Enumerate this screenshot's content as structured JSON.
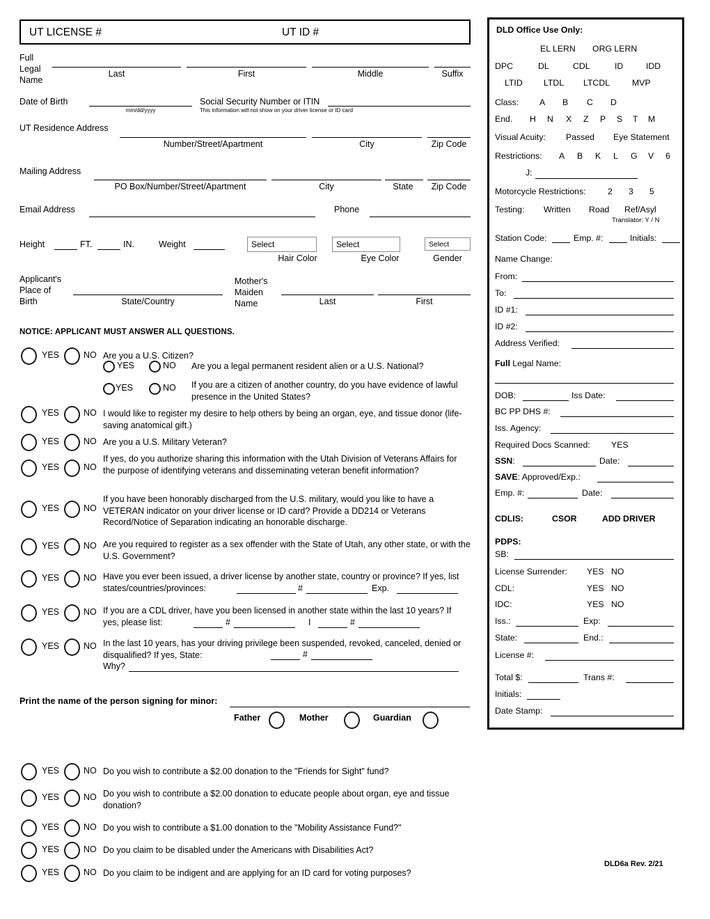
{
  "header": {
    "license_label": "UT LICENSE #",
    "id_label": "UT ID #"
  },
  "personal": {
    "full_legal_name_label": [
      "Full",
      "Legal",
      "Name"
    ],
    "name_parts": [
      "Last",
      "First",
      "Middle",
      "Suffix"
    ],
    "dob_label": "Date of Birth",
    "dob_format": "mm/dd/yyyy",
    "ssn_label": "Social Security Number or ITIN",
    "ssn_note": "This information will not show on your driver license or ID card",
    "residence_label": "UT Residence Address",
    "residence_parts": [
      "Number/Street/Apartment",
      "City",
      "Zip Code"
    ],
    "mailing_label": "Mailing Address",
    "mailing_parts": [
      "PO Box/Number/Street/Apartment",
      "City",
      "State",
      "Zip Code"
    ],
    "email_label": "Email Address",
    "phone_label": "Phone"
  },
  "physical": {
    "height_label": "Height",
    "ft_label": "FT.",
    "in_label": "IN.",
    "weight_label": "Weight",
    "hair_color_value": "Select",
    "hair_color_label": "Hair Color",
    "eye_color_value": "Select",
    "eye_color_label": "Eye Color",
    "gender_value": "Select",
    "gender_label": "Gender"
  },
  "birth": {
    "applicant_place_label": [
      "Applicant's",
      "Place of",
      "Birth"
    ],
    "state_country_label": "State/Country",
    "mother_label": [
      "Mother's",
      "Maiden",
      "Name"
    ],
    "mother_parts": [
      "Last",
      "First"
    ]
  },
  "notice": "NOTICE:  APPLICANT MUST ANSWER ALL QUESTIONS.",
  "yes_label": "YES",
  "no_label": "NO",
  "questions": [
    {
      "id": "us-citizen",
      "text": "Are you a U.S. Citizen?"
    },
    {
      "id": "permanent-resident",
      "text": "Are you a legal permanent resident alien or a U.S. National?",
      "indent": true
    },
    {
      "id": "lawful-presence",
      "text": "If you are a citizen of another country, do you have evidence of lawful presence in the United States?",
      "indent": true
    },
    {
      "id": "organ-donor",
      "text": "I would like to register my desire to help others by being an organ, eye, and tissue donor (life-saving anatomical gift.)"
    },
    {
      "id": "military-veteran",
      "text": "Are you a U.S. Military Veteran?"
    },
    {
      "id": "veterans-affairs-sharing",
      "text": "If yes, do you authorize sharing this information with the Utah Division of Veterans Affairs for the purpose of identifying veterans and disseminating veteran benefit information?"
    },
    {
      "id": "veteran-indicator",
      "text": "If you have been honorably discharged from the U.S. military, would you like to have a VETERAN indicator on your driver license or ID card?  Provide a DD214 or Veterans Record/Notice of Separation indicating an honorable discharge."
    },
    {
      "id": "sex-offender",
      "text": "Are you required to register as a sex offender with the State of Utah, any other state, or with the U.S. Government?"
    },
    {
      "id": "other-state-license",
      "text": "Have you ever been issued, a driver license by another state, country or province?  If yes, list states/countries/provinces:"
    },
    {
      "id": "cdl-other-state",
      "text": "If you are a CDL driver, have you been licensed in another state within the last 10 years?  If yes, please list:"
    },
    {
      "id": "suspended-revoked",
      "text": "In the last 10 years, has your driving privilege been suspended, revoked, canceled, denied  or  disqualified?  If yes, State:"
    }
  ],
  "inline_fields": {
    "hash": "#",
    "exp": "Exp.",
    "pipe": "I",
    "why": "Why?"
  },
  "minor": {
    "print_name_label": "Print the name of the person signing for minor:",
    "options": [
      "Father",
      "Mother",
      "Guardian"
    ]
  },
  "donations": [
    {
      "id": "friends-for-sight",
      "text": "Do you wish to contribute a $2.00 donation to the \"Friends for Sight\" fund?"
    },
    {
      "id": "organ-eye-tissue-education",
      "text": "Do you wish to contribute a $2.00 donation to educate people about organ, eye and tissue donation?"
    },
    {
      "id": "mobility-assistance-fund",
      "text": "Do you wish to contribute a $1.00 donation to the \"Mobility Assistance Fund?\""
    },
    {
      "id": "ada-disabled",
      "text": "Do you claim to be disabled under the Americans with Disabilities Act?"
    },
    {
      "id": "indigent-voting-id",
      "text": "Do you claim to be indigent and are applying for an ID card for voting purposes?"
    }
  ],
  "office": {
    "title": "DLD Office Use Only:",
    "lern_row": [
      "EL LERN",
      "ORG LERN"
    ],
    "doc_types_row1": [
      "DPC",
      "DL",
      "CDL",
      "ID",
      "IDD"
    ],
    "doc_types_row2": [
      "LTID",
      "LTDL",
      "LTCDL",
      "MVP"
    ],
    "class_label": "Class:",
    "class_options": [
      "A",
      "B",
      "C",
      "D"
    ],
    "end_label": "End.",
    "end_options": [
      "H",
      "N",
      "X",
      "Z",
      "P",
      "S",
      "T",
      "M"
    ],
    "visual_acuity_label": "Visual Acuity:",
    "visual_acuity_options": [
      "Passed",
      "Eye Statement"
    ],
    "restrictions_label": "Restrictions:",
    "restrictions_options": [
      "A",
      "B",
      "K",
      "L",
      "G",
      "V",
      "6"
    ],
    "restriction_j_label": "J:",
    "motorcycle_label": "Motorcycle Restrictions:",
    "motorcycle_options": [
      "2",
      "3",
      "5"
    ],
    "testing_label": "Testing:",
    "testing_options": [
      "Written",
      "Road",
      "Ref/Asyl"
    ],
    "translator_label": "Translator: Y / N",
    "station_code_label": "Station Code:",
    "emp_label": "Emp. #:",
    "initials_label": "Initials:",
    "name_change_label": "Name Change:",
    "from_label": "From:",
    "to_label": "To:",
    "id1_label": "ID #1:",
    "id2_label": "ID #2:",
    "address_verified_label": "Address Verified:",
    "full_legal_name_bold": "Full",
    "full_legal_name_rest": " Legal Name:",
    "dob_label": "DOB:",
    "iss_date_label": "Iss Date:",
    "bc_pp_dhs_label": "BC PP DHS #:",
    "iss_agency_label": "Iss. Agency:",
    "required_docs_label": "Required Docs Scanned:",
    "required_docs_value": "YES",
    "ssn_bold": "SSN",
    "ssn_rest": ":",
    "ssn_date_label": "Date:",
    "save_bold": "SAVE",
    "save_rest": ": Approved/Exp.:",
    "emp2_label": "Emp. #:",
    "emp2_date_label": "Date:",
    "cdlis_bold": "CDLIS",
    "cdlis_rest": ":",
    "csor_label": "CSOR",
    "add_driver_label": "ADD DRIVER",
    "pdps_bold": "PDPS",
    "pdps_rest": ":",
    "sb_label": "SB:",
    "license_surrender_label": "License Surrender:",
    "cdl_label": "CDL:",
    "idc_label": "IDC:",
    "yes": "YES",
    "no": "NO",
    "iss_label": "Iss.:",
    "exp_label": "Exp:",
    "state_label": "State:",
    "end2_label": "End.:",
    "license_num_label": "License #:",
    "total_label": "Total $:",
    "trans_label": "Trans #:",
    "initials2_label": "Initials:",
    "date_stamp_label": "Date Stamp:"
  },
  "footer": {
    "revision": "DLD6a Rev. 2/21"
  }
}
